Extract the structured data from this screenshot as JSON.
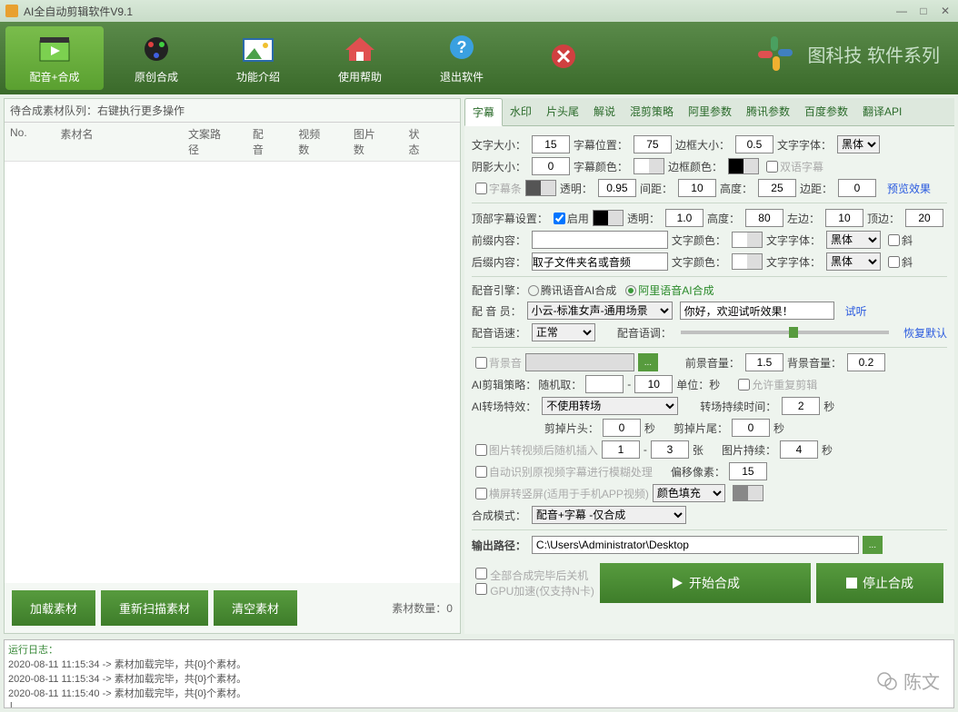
{
  "window": {
    "title": "AI全自动剪辑软件V9.1"
  },
  "toolbar": {
    "items": [
      {
        "label": "配音+合成"
      },
      {
        "label": "原创合成"
      },
      {
        "label": "功能介绍"
      },
      {
        "label": "使用帮助"
      },
      {
        "label": "退出软件"
      }
    ],
    "brand": "图科技 软件系列"
  },
  "left": {
    "header": "待合成素材队列：右键执行更多操作",
    "cols": {
      "no": "No.",
      "name": "素材名",
      "path": "文案路径",
      "voice": "配音",
      "frames": "视频数",
      "imgs": "图片数",
      "status": "状态"
    },
    "btn_load": "加载素材",
    "btn_rescan": "重新扫描素材",
    "btn_clear": "清空素材",
    "count_label": "素材数量：",
    "count_value": "0"
  },
  "tabs": [
    "字幕",
    "水印",
    "片头尾",
    "解说",
    "混剪策略",
    "阿里参数",
    "腾讯参数",
    "百度参数",
    "翻译API"
  ],
  "subtitle": {
    "font_size_l": "文字大小：",
    "font_size": "15",
    "pos_l": "字幕位置：",
    "pos": "75",
    "border_l": "边框大小：",
    "border": "0.5",
    "font_l": "文字字体：",
    "font": "黑体",
    "shadow_l": "阴影大小：",
    "shadow": "0",
    "color_l": "字幕颜色：",
    "bcolor_l": "边框颜色：",
    "bilingual_l": "双语字幕",
    "bar_l": "字幕条",
    "opacity_l": "透明：",
    "opacity": "0.95",
    "gap_l": "间距：",
    "gap": "10",
    "height_l": "高度：",
    "height": "25",
    "margin_l": "边距：",
    "margin": "0",
    "preview": "预览效果",
    "top_set_l": "顶部字幕设置：",
    "enable_l": "启用",
    "top_opacity": "1.0",
    "top_height": "80",
    "top_left": "10",
    "top_margin": "20",
    "left_label": "左边：",
    "top_margin_l": "顶边：",
    "prefix_l": "前缀内容：",
    "prefix": "",
    "suffix_l": "后缀内容：",
    "suffix": "取子文件夹名或音频",
    "txtcolor_l": "文字颜色：",
    "txtfont_l": "文字字体：",
    "italic_l": "斜"
  },
  "voice": {
    "engine_l": "配音引擎：",
    "engine_tencent": "腾讯语音AI合成",
    "engine_ali": "阿里语音AI合成",
    "actor_l": "配 音 员：",
    "actor": "小云-标准女声-通用场景",
    "sample": "你好，欢迎试听效果！",
    "listen": "试听",
    "speed_l": "配音语速：",
    "speed": "正常",
    "tone_l": "配音语调：",
    "reset": "恢复默认",
    "bgm_l": "背景音",
    "fg_vol_l": "前景音量：",
    "fg_vol": "1.5",
    "bg_vol_l": "背景音量：",
    "bg_vol": "0.2"
  },
  "clip": {
    "strategy_l": "AI剪辑策略：",
    "rand_l": "随机取：",
    "rand_min": "",
    "to": "-",
    "rand_max": "10",
    "unit": "单位：秒",
    "allow_dup_l": "允许重复剪辑",
    "transition_l": "AI转场特效：",
    "transition": "不使用转场",
    "trans_dur_l": "转场持续时间：",
    "trans_dur": "2",
    "sec": "秒",
    "trim_head_l": "剪掉片头：",
    "trim_head": "0",
    "trim_tail_l": "剪掉片尾：",
    "trim_tail": "0",
    "img2vid_l": "图片转视频后随机插入",
    "img_min": "1",
    "img_max": "3",
    "zhang": "张",
    "img_dur_l": "图片持续：",
    "img_dur": "4",
    "blur_l": "自动识别原视频字幕进行模糊处理",
    "offset_l": "偏移像素：",
    "offset": "15",
    "portrait_l": "横屏转竖屏(适用于手机APP视频)",
    "fill_l": "颜色填充",
    "mode_l": "合成模式：",
    "mode": "配音+字幕 -仅合成",
    "out_l": "输出路径：",
    "out": "C:\\Users\\Administrator\\Desktop"
  },
  "footer": {
    "shutdown_l": "全部合成完毕后关机",
    "gpu_l": "GPU加速(仅支持N卡)",
    "start": "开始合成",
    "stop": "停止合成"
  },
  "log": {
    "head": "运行日志：",
    "lines": [
      "2020-08-11 11:15:34 -> 素材加载完毕，共{0}个素材。",
      "2020-08-11 11:15:34 -> 素材加载完毕，共{0}个素材。",
      "2020-08-11 11:15:40 -> 素材加载完毕，共{0}个素材。"
    ]
  },
  "watermark": "陈文"
}
